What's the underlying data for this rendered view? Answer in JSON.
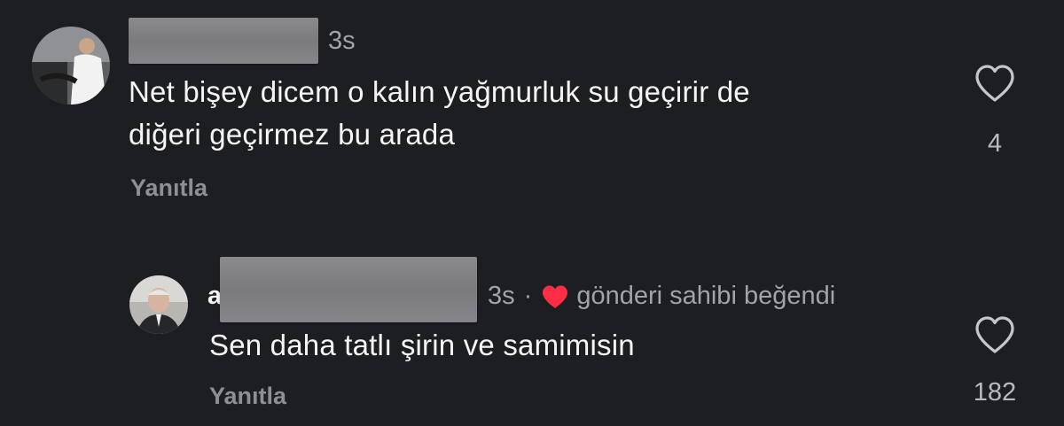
{
  "comments": [
    {
      "time": "3s",
      "text_line1": "Net bişey dicem o kalın yağmurluk su geçirir de",
      "text_line2": "diğeri geçirmez bu arada",
      "reply_label": "Yanıtla",
      "like_count": "4",
      "avatar_icon": "user-avatar-photo"
    },
    {
      "name_initial": "a",
      "time": "3s",
      "separator": "·",
      "liked_by_author": "gönderi sahibi beğendi",
      "text": "Sen daha tatlı şirin ve samimisin",
      "reply_label": "Yanıtla",
      "like_count": "182",
      "avatar_icon": "user-avatar-photo"
    }
  ],
  "colors": {
    "background": "#1d1e22",
    "text": "#f5f5f5",
    "muted": "#a2a3a8",
    "heart_red": "#ff2d45"
  }
}
